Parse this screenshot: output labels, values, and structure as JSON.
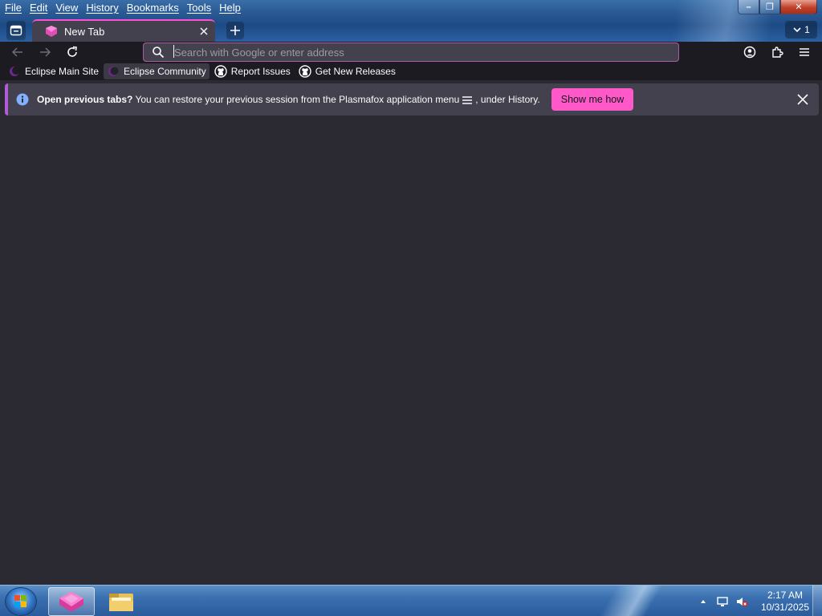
{
  "menubar": {
    "items": [
      "File",
      "Edit",
      "View",
      "History",
      "Bookmarks",
      "Tools",
      "Help"
    ]
  },
  "window_controls": {
    "minimize": "–",
    "maximize": "❐",
    "close": "✕"
  },
  "tabs": {
    "active_title": "New Tab",
    "all_tabs_count": "1"
  },
  "navbar": {
    "url_value": "",
    "url_placeholder": "Search with Google or enter address"
  },
  "bookmarks": [
    {
      "label": "Eclipse Main Site",
      "icon": "eclipse-icon"
    },
    {
      "label": "Eclipse Community",
      "icon": "eclipse-icon"
    },
    {
      "label": "Report Issues",
      "icon": "github-icon"
    },
    {
      "label": "Get New Releases",
      "icon": "github-icon"
    }
  ],
  "notification": {
    "bold": "Open previous tabs?",
    "text_before_icon": " You can restore your previous session from the Plasmafox application menu",
    "text_after_icon": ", under History.",
    "button": "Show me how"
  },
  "taskbar": {
    "time": "2:17 AM",
    "date": "10/31/2025"
  },
  "colors": {
    "accent": "#ff59c9",
    "toolbar": "#1c1b22",
    "content_bg": "#2b2a33"
  }
}
